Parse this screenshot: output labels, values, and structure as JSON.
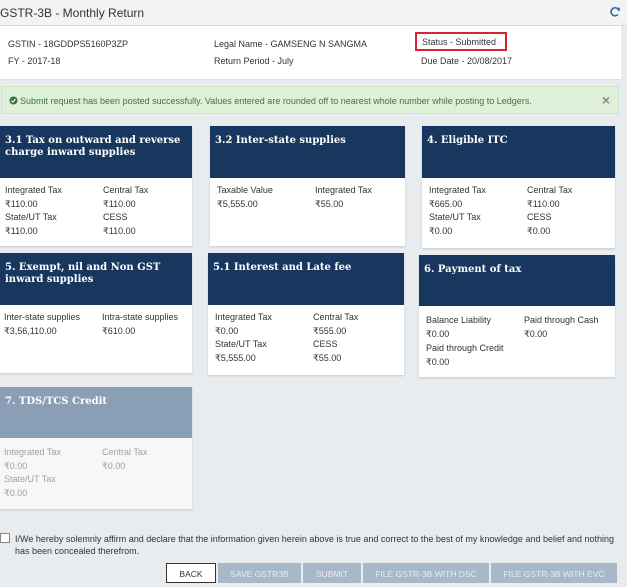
{
  "header": {
    "title": "GSTR-3B - Monthly Return",
    "gstin": "GSTIN - 18GDDPS5160P3ZP",
    "legal_name": "Legal Name - GAMSENG N SANGMA",
    "status": "Status - Submitted",
    "fy": "FY - 2017-18",
    "return_period": "Return Period - July",
    "due_date": "Due Date - 20/08/2017"
  },
  "alert": {
    "message": "Submit request has been posted successfully. Values entered are rounded off to nearest whole number while posting to Ledgers.",
    "close": "×",
    "color": "#dff0d8"
  },
  "cards": {
    "c31": {
      "title": "3.1 Tax on outward and reverse charge inward supplies",
      "integrated_label": "Integrated Tax",
      "integrated_value": "₹110.00",
      "central_label": "Central Tax",
      "central_value": "₹110.00",
      "state_label": "State/UT Tax",
      "state_value": "₹110.00",
      "cess_label": "CESS",
      "cess_value": "₹110.00"
    },
    "c32": {
      "title": "3.2 Inter-state supplies",
      "taxable_label": "Taxable Value",
      "taxable_value": "₹5,555.00",
      "integrated_label": "Integrated Tax",
      "integrated_value": "₹55.00"
    },
    "c4": {
      "title": "4. Eligible ITC",
      "integrated_label": "Integrated Tax",
      "integrated_value": "₹665.00",
      "central_label": "Central Tax",
      "central_value": "₹110.00",
      "state_label": "State/UT Tax",
      "state_value": "₹0.00",
      "cess_label": "CESS",
      "cess_value": "₹0.00"
    },
    "c5": {
      "title": "5. Exempt, nil and Non GST inward supplies",
      "inter_label": "Inter-state supplies",
      "inter_value": "₹3,56,110.00",
      "intra_label": "Intra-state supplies",
      "intra_value": "₹610.00"
    },
    "c51": {
      "title": "5.1 Interest and Late fee",
      "integrated_label": "Integrated Tax",
      "integrated_value": "₹0.00",
      "central_label": "Central Tax",
      "central_value": "₹555.00",
      "state_label": "State/UT Tax",
      "state_value": "₹5,555.00",
      "cess_label": "CESS",
      "cess_value": "₹55.00"
    },
    "c6": {
      "title": "6. Payment of tax",
      "balance_label": "Balance Liability",
      "balance_value": "₹0.00",
      "cash_label": "Paid through Cash",
      "cash_value": "₹0.00",
      "credit_label": "Paid through Credit",
      "credit_value": "₹0.00"
    },
    "c7": {
      "title": "7. TDS/TCS Credit",
      "integrated_label": "Integrated Tax",
      "integrated_value": "₹0.00",
      "central_label": "Central Tax",
      "central_value": "₹0.00",
      "state_label": "State/UT Tax",
      "state_value": "₹0.00"
    }
  },
  "declaration": "I/We hereby solemnly affirm and declare that the information given herein above is true and correct to the best of my knowledge and belief and nothing has been concealed therefrom.",
  "buttons": {
    "back": "BACK",
    "save": "SAVE GSTR3B",
    "submit": "SUBMIT",
    "file_dsc": "FILE GSTR-3B WITH DSC",
    "file_evc": "FILE GSTR-3B WITH EVC"
  },
  "colors": {
    "card_header": "#17375e",
    "card_header_disabled": "#8a9eb5",
    "status_border": "#d9232e",
    "button_disabled": "#a8b8c8"
  },
  "icons": {
    "refresh": "refresh-icon",
    "success": "check-circle-icon",
    "close": "close-icon"
  }
}
